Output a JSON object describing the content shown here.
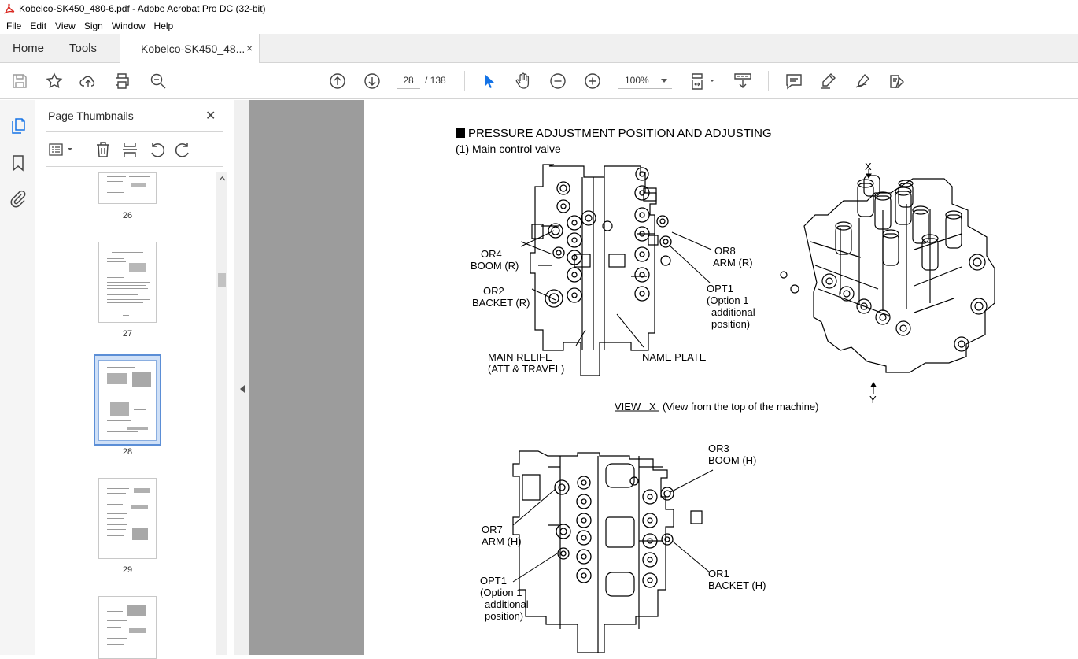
{
  "window": {
    "title": "Kobelco-SK450_480-6.pdf - Adobe Acrobat Pro DC (32-bit)"
  },
  "menu": [
    "File",
    "Edit",
    "View",
    "Sign",
    "Window",
    "Help"
  ],
  "tabs": {
    "home": "Home",
    "tools": "Tools",
    "document": "Kobelco-SK450_48...",
    "close": "×"
  },
  "toolbar": {
    "page_current": "28",
    "page_total": "/ 138",
    "zoom": "100%",
    "icons": [
      "save-icon",
      "bookmark-star-icon",
      "upload-cloud-icon",
      "print-icon",
      "search-zoom-icon",
      "previous-page-icon",
      "next-page-icon",
      "select-cursor-icon",
      "hand-tool-icon",
      "zoom-out-icon",
      "zoom-in-icon",
      "page-fit-icon",
      "scroll-mode-icon",
      "comment-icon",
      "highlight-pen-icon",
      "sign-icon",
      "fill-sign-icon"
    ]
  },
  "left_rail": {
    "icons": [
      "page-thumbnails-icon",
      "bookmarks-icon",
      "attachments-icon"
    ]
  },
  "thumbnails_panel": {
    "title": "Page Thumbnails",
    "close": "✕",
    "tools": [
      "options-menu-icon",
      "delete-page-icon",
      "extract-page-icon",
      "rotate-left-icon",
      "rotate-right-icon"
    ],
    "pages": [
      {
        "label": "26",
        "selected": false
      },
      {
        "label": "27",
        "selected": false
      },
      {
        "label": "28",
        "selected": true
      },
      {
        "label": "29",
        "selected": false
      },
      {
        "label": "",
        "selected": false
      }
    ]
  },
  "document_page": {
    "heading": "PRESSURE ADJUSTMENT POSITION AND ADJUSTING",
    "subheading": "(1) Main control valve",
    "labels_top": {
      "or4": "OR4",
      "or4_desc": "BOOM (R)",
      "or2": "OR2",
      "or2_desc": "BACKET (R)",
      "main_relief": "MAIN RELIFE",
      "main_relief_desc": "(ATT & TRAVEL)",
      "name_plate": "NAME PLATE",
      "or8": "OR8",
      "or8_desc": "ARM (R)",
      "opt1": "OPT1",
      "opt1_desc1": "(Option 1",
      "opt1_desc2": "additional",
      "opt1_desc3": "position)",
      "x_marker": "X",
      "y_marker": "Y",
      "view_x": "VIEW   X",
      "view_x_desc": "(View from the top of the machine)"
    },
    "labels_bottom": {
      "or3": "OR3",
      "or3_desc": "BOOM (H)",
      "or7": "OR7",
      "or7_desc": "ARM (H)",
      "opt1": "OPT1",
      "opt1_desc1": "(Option 1",
      "opt1_desc2": "additional",
      "opt1_desc3": "position)",
      "or1": "OR1",
      "or1_desc": "BACKET (H)"
    }
  },
  "colors": {
    "accent_blue": "#1473e6",
    "selection": "#5b8ed6",
    "app_red": "#d8231b",
    "viewer_gray": "#9c9c9c"
  }
}
